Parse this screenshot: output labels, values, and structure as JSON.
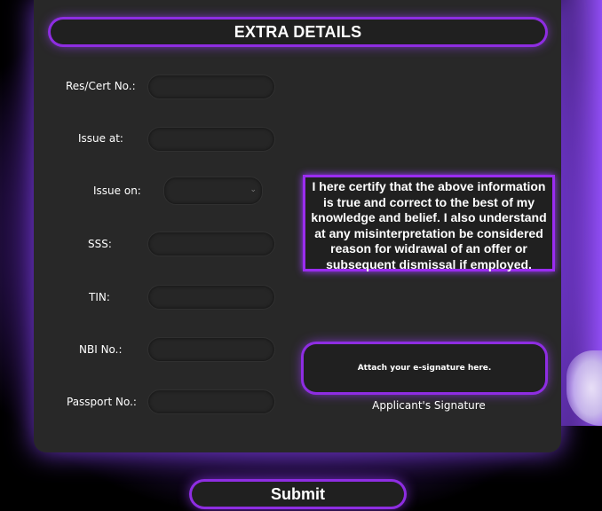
{
  "header": {
    "title": "EXTRA DETAILS"
  },
  "fields": [
    {
      "label": "Res/Cert No.:",
      "value": ""
    },
    {
      "label": "Issue at:",
      "value": ""
    },
    {
      "label": "Issue on:",
      "value": ""
    },
    {
      "label": "SSS:",
      "value": ""
    },
    {
      "label": "TIN:",
      "value": ""
    },
    {
      "label": "NBI No.:",
      "value": ""
    },
    {
      "label": "Passport No.:",
      "value": ""
    }
  ],
  "certification": {
    "text": "I here certify that the above information is true and correct to the best of my knowledge and belief. I also understand at any misinterpretation be considered reason for widrawal of an offer or subsequent dismissal if employed."
  },
  "signature": {
    "prompt": "Attach your e-signature here.",
    "caption": "Applicant's Signature"
  },
  "submit": {
    "label": "Submit"
  },
  "colors": {
    "accent": "#8e2de2",
    "glow": "#9b3cff",
    "panel": "#282828"
  },
  "icons": {
    "select_chevron": "chevron-down-icon"
  }
}
